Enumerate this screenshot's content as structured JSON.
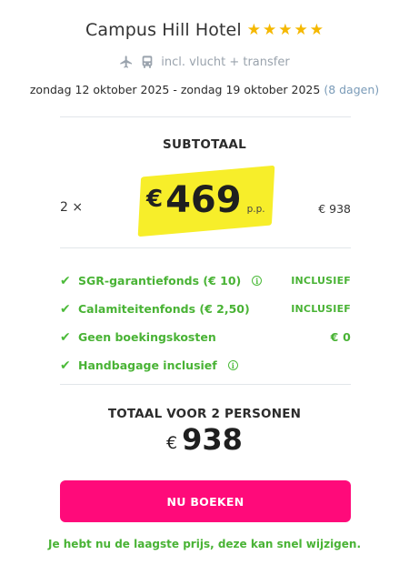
{
  "hotel": {
    "name": "Campus Hill Hotel",
    "stars": 5,
    "star_icon": "★",
    "star_color": "#f5b800"
  },
  "transport": {
    "icons": [
      "plane-icon",
      "bus-icon"
    ],
    "label": "incl. vlucht + transfer"
  },
  "dates": {
    "range": "zondag 12 oktober 2025 - zondag 19 oktober 2025",
    "duration": "(8 dagen)"
  },
  "subtotal": {
    "title": "SUBTOTAAL",
    "quantity": "2 ×",
    "currency": "€",
    "price_per_person": "469",
    "pp_label": "p.p.",
    "subtotal_amount": "€ 938",
    "highlight_color": "#f7ee2a"
  },
  "features": [
    {
      "label": "SGR-garantiefonds  (€ 10)",
      "info": true,
      "value": "INCLUSIEF"
    },
    {
      "label": "Calamiteitenfonds  (€ 2,50)",
      "info": false,
      "value": "INCLUSIEF"
    },
    {
      "label": "Geen boekingskosten",
      "info": false,
      "value": "€ 0"
    },
    {
      "label": "Handbagage inclusief",
      "info": true,
      "value": ""
    }
  ],
  "total": {
    "title": "TOTAAL VOOR 2 PERSONEN",
    "currency": "€",
    "amount": "938"
  },
  "actions": {
    "book_label": "NU BOEKEN",
    "book_color": "#ff0a7a"
  },
  "notice": "Je hebt nu de laagste prijs, deze kan snel wijzigen.",
  "colors": {
    "accent_green": "#49b335",
    "muted_blue": "#7a9bb8"
  }
}
